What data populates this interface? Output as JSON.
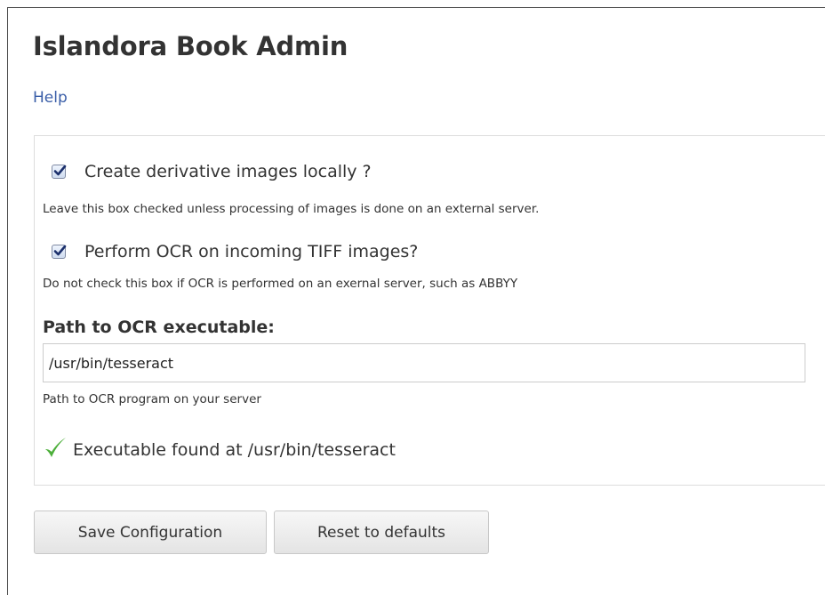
{
  "page": {
    "title": "Islandora Book Admin",
    "help_link": "Help"
  },
  "form": {
    "create_derivatives": {
      "label": "Create derivative images locally ?",
      "checked": true,
      "description": "Leave this box checked unless processing of images is done on an external server."
    },
    "perform_ocr": {
      "label": "Perform OCR on incoming TIFF images?",
      "checked": true,
      "description": "Do not check this box if OCR is performed on an exernal server, such as ABBYY"
    },
    "ocr_path": {
      "label": "Path to OCR executable:",
      "value": "/usr/bin/tesseract",
      "description": "Path to OCR program on your server"
    },
    "status": {
      "icon": "checkmark-icon",
      "icon_color": "#4caf3a",
      "text": "Executable found at /usr/bin/tesseract"
    }
  },
  "actions": {
    "save_label": "Save Configuration",
    "reset_label": "Reset to defaults"
  },
  "colors": {
    "link": "#3a5ea8",
    "text": "#333333"
  }
}
